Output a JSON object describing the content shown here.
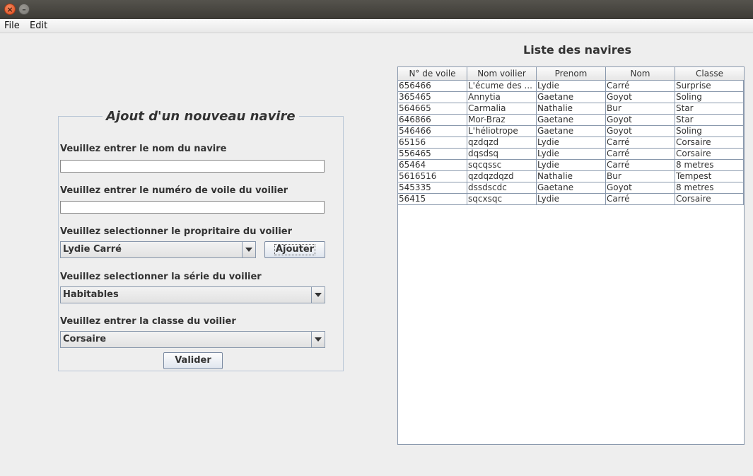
{
  "window": {
    "close_glyph": "×",
    "minimize_glyph": "–"
  },
  "menubar": {
    "items": [
      {
        "label": "File"
      },
      {
        "label": "Edit"
      }
    ]
  },
  "form": {
    "title": "Ajout d'un nouveau navire",
    "name_label": "Veuillez entrer le nom du navire",
    "name_value": "",
    "sail_label": "Veuillez entrer le numéro de voile du voilier",
    "sail_value": "",
    "owner_label": "Veuillez selectionner le propritaire du voilier",
    "owner_selected": "Lydie Carré",
    "add_button": "Ajouter",
    "series_label": "Veuillez selectionner la série du voilier",
    "series_selected": "Habitables",
    "class_label": "Veuillez entrer la classe du voilier",
    "class_selected": "Corsaire",
    "submit_button": "Valider"
  },
  "list": {
    "title": "Liste des navires",
    "columns": [
      "N° de voile",
      "Nom voilier",
      "Prenom",
      "Nom",
      "Classe"
    ],
    "rows": [
      [
        "656466",
        "L'écume des ...",
        "Lydie",
        "Carré",
        "Surprise"
      ],
      [
        "365465",
        "Annytia",
        "Gaetane",
        "Goyot",
        "Soling"
      ],
      [
        "564665",
        "Carmalia",
        "Nathalie",
        "Bur",
        "Star"
      ],
      [
        "646866",
        "Mor-Braz",
        "Gaetane",
        "Goyot",
        "Star"
      ],
      [
        "546466",
        "L'héliotrope",
        "Gaetane",
        "Goyot",
        "Soling"
      ],
      [
        "65156",
        "qzdqzd",
        "Lydie",
        "Carré",
        "Corsaire"
      ],
      [
        "556465",
        "dqsdsq",
        "Lydie",
        "Carré",
        "Corsaire"
      ],
      [
        "65464",
        "sqcqssc",
        "Lydie",
        "Carré",
        "8 metres"
      ],
      [
        "5616516",
        "qzdqzdqzd",
        "Nathalie",
        "Bur",
        "Tempest"
      ],
      [
        "545335",
        "dssdscdc",
        "Gaetane",
        "Goyot",
        "8 metres"
      ],
      [
        "56415",
        "sqcxsqc",
        "Lydie",
        "Carré",
        "Corsaire"
      ]
    ]
  },
  "colors": {
    "background": "#eeeeee",
    "panel_border": "#b9c6d6",
    "grid": "#8a99ad",
    "close_button": "#dd4b1e"
  }
}
